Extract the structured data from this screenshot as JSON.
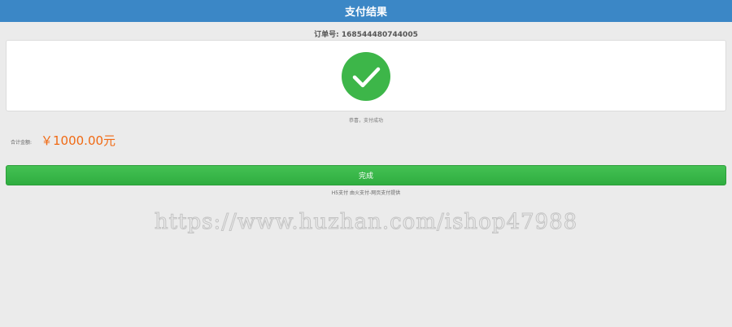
{
  "header": {
    "title": "支付结果"
  },
  "order": {
    "label": "订单号:",
    "number": "168544480744005"
  },
  "result": {
    "icon": "check-circle-icon",
    "status_text": "恭喜，支付成功"
  },
  "amount": {
    "label": "合计金额:",
    "value": "￥1000.00元"
  },
  "actions": {
    "done_label": "完成"
  },
  "footer": {
    "provider_text": "H5支付 由火支付-网页支付提供"
  },
  "watermark": {
    "text": "https://www.huzhan.com/ishop47988"
  },
  "colors": {
    "header": "#3b87c6",
    "success": "#3db649",
    "amount": "#f06a14",
    "background": "#ebebeb"
  }
}
